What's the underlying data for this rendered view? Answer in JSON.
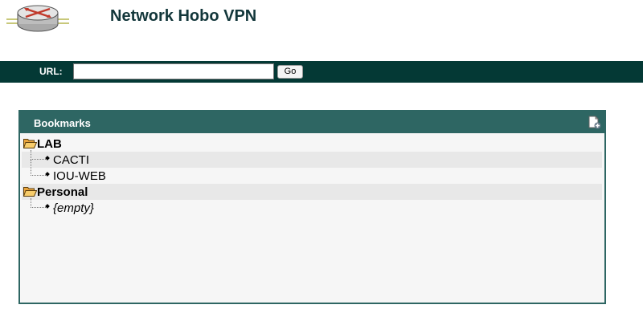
{
  "header": {
    "title": "Network Hobo VPN",
    "logo_icon": "router-icon"
  },
  "url_bar": {
    "label": "URL:",
    "input_value": "",
    "go_label": "Go"
  },
  "bookmarks": {
    "title": "Bookmarks",
    "add_icon": "add-page-icon",
    "folders": [
      {
        "name": "LAB",
        "items": [
          "CACTI",
          "IOU-WEB"
        ]
      },
      {
        "name": "Personal",
        "items": [
          "{empty}"
        ]
      }
    ]
  },
  "colors": {
    "url_bar_bg": "#043935",
    "panel_header_bg": "#2e6663",
    "title_text": "#12363a",
    "panel_bg": "#f6f6f6",
    "row_shade": "#e8e8e8"
  }
}
